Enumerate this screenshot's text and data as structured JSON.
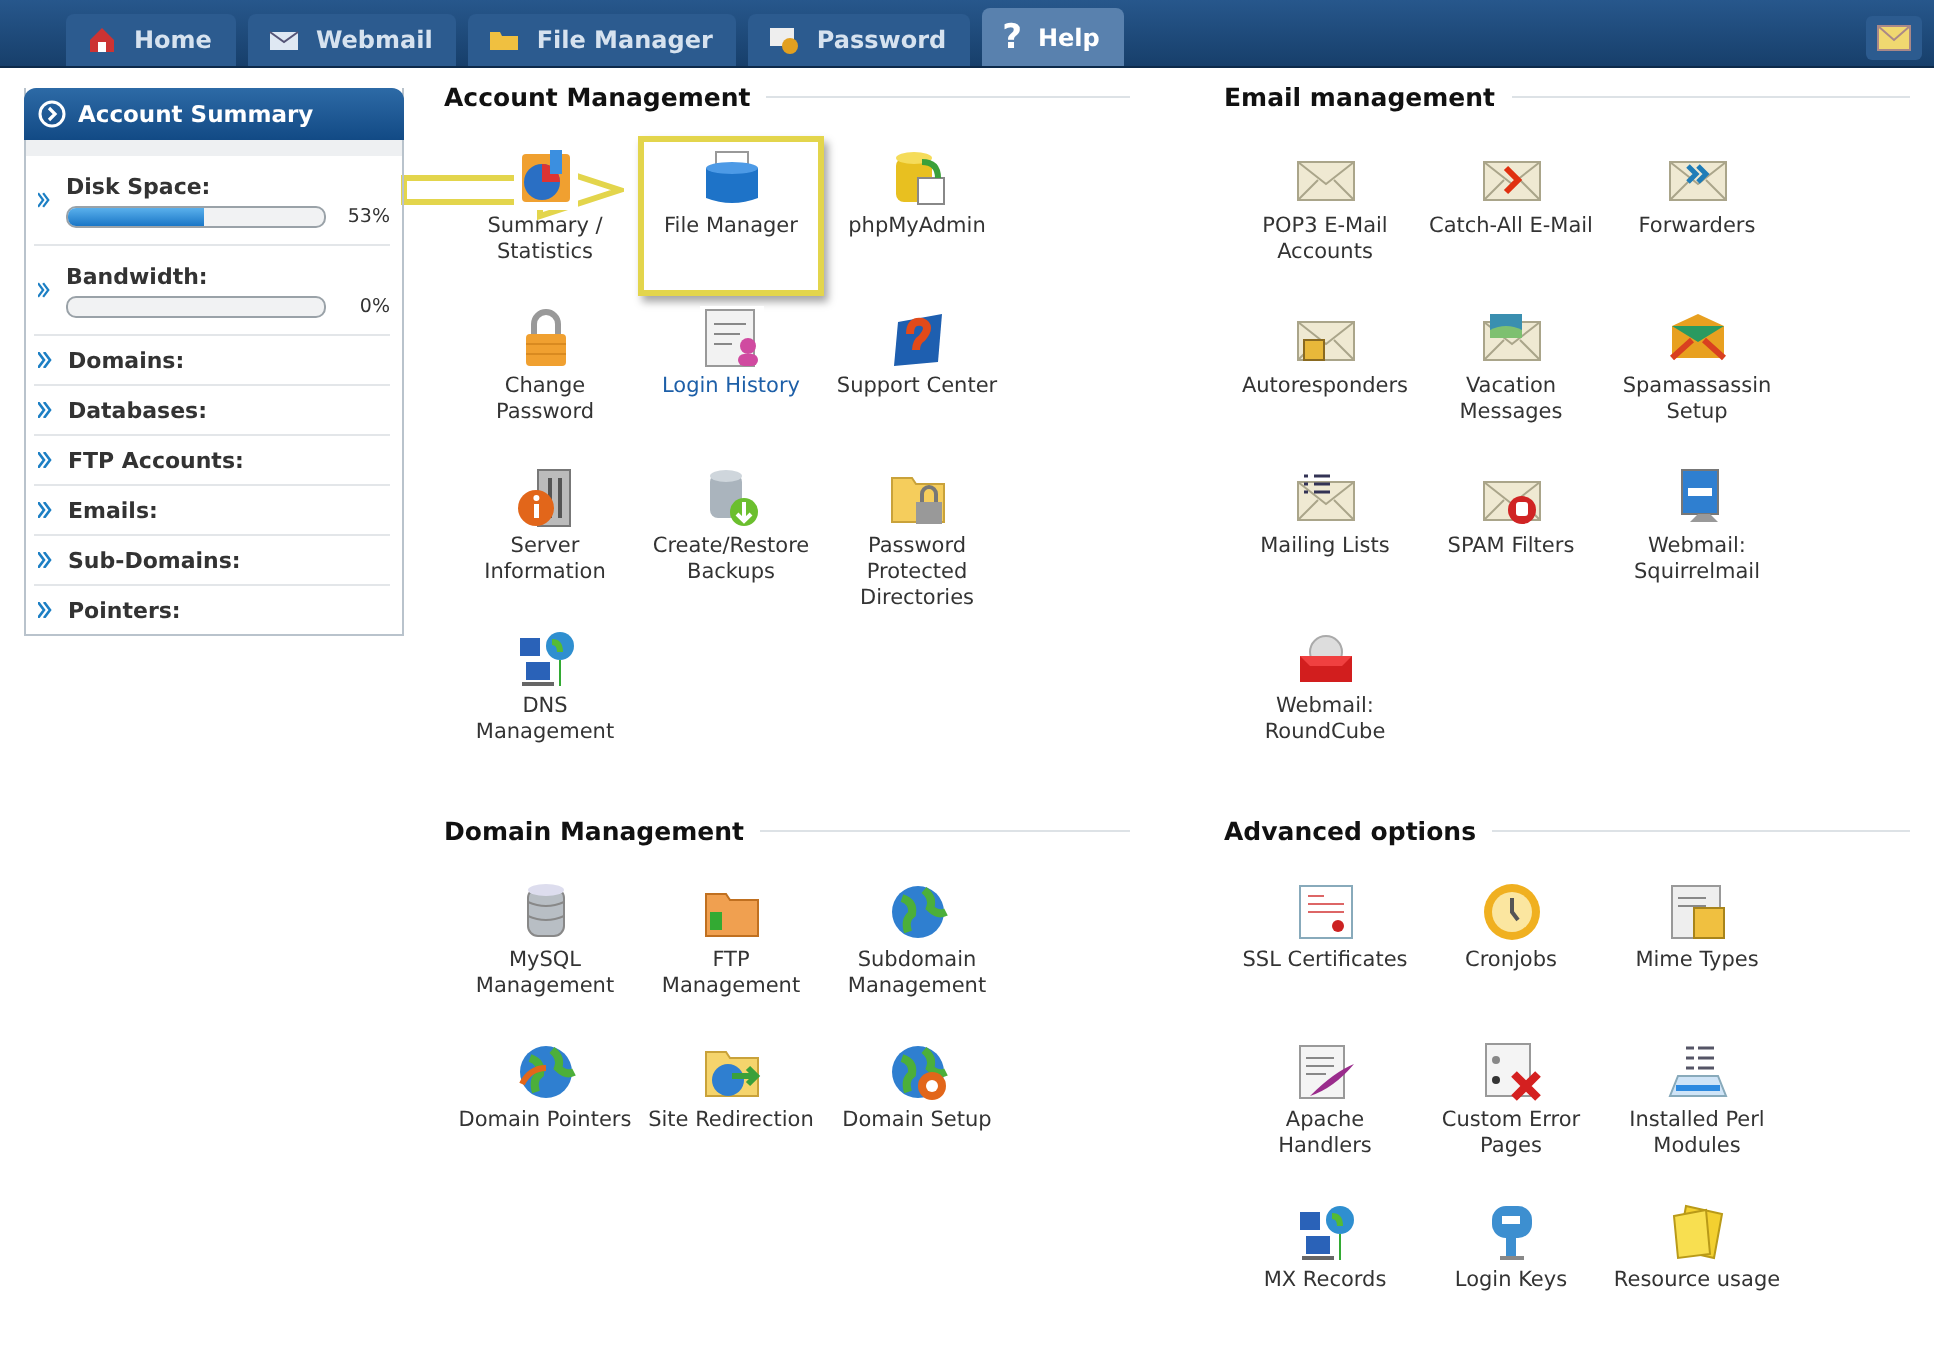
{
  "tabs": [
    {
      "label": "Home",
      "selected": false
    },
    {
      "label": "Webmail",
      "selected": false
    },
    {
      "label": "File Manager",
      "selected": false
    },
    {
      "label": "Password",
      "selected": false
    },
    {
      "label": "Help",
      "glyph": "?",
      "selected": true
    }
  ],
  "sidebar": {
    "title": "Account Summary",
    "items": [
      {
        "kind": "meter",
        "label": "Disk Space:",
        "level": 0.53,
        "reading": "53%"
      },
      {
        "kind": "meter",
        "label": "Bandwidth:",
        "level": 0,
        "reading": "0%"
      },
      {
        "kind": "plain",
        "label": "Domains:"
      },
      {
        "kind": "plain",
        "label": "Databases:"
      },
      {
        "kind": "plain",
        "label": "FTP Accounts:"
      },
      {
        "kind": "plain",
        "label": "Emails:"
      },
      {
        "kind": "plain",
        "label": "Sub-Domains:"
      },
      {
        "kind": "plain",
        "label": "Pointers:"
      }
    ]
  },
  "sections": [
    {
      "title": "Account Management",
      "items": [
        {
          "label": "Summary / Statistics",
          "link": false,
          "highlighted": false
        },
        {
          "label": "File Manager",
          "link": false,
          "highlighted": true
        },
        {
          "label": "phpMyAdmin",
          "link": false,
          "highlighted": false
        },
        {
          "label": "Change Password",
          "link": false,
          "highlighted": false
        },
        {
          "label": "Login History",
          "link": true,
          "highlighted": false
        },
        {
          "label": "Support Center",
          "link": false,
          "highlighted": false
        },
        {
          "label": "Server Information",
          "link": false,
          "highlighted": false
        },
        {
          "label": "Create/Restore Backups",
          "link": false,
          "highlighted": false
        },
        {
          "label": "Password Protected Directories",
          "link": false,
          "highlighted": false
        },
        {
          "label": "DNS Management",
          "link": false,
          "highlighted": false
        }
      ]
    },
    {
      "title": "Email management",
      "items": [
        {
          "label": "POP3 E-Mail Accounts",
          "link": false,
          "highlighted": false
        },
        {
          "label": "Catch-All E-Mail",
          "link": false,
          "highlighted": false
        },
        {
          "label": "Forwarders",
          "link": false,
          "highlighted": false
        },
        {
          "label": "Autoresponders",
          "link": false,
          "highlighted": false
        },
        {
          "label": "Vacation Messages",
          "link": false,
          "highlighted": false
        },
        {
          "label": "Spamassassin Setup",
          "link": false,
          "highlighted": false
        },
        {
          "label": "Mailing Lists",
          "link": false,
          "highlighted": false
        },
        {
          "label": "SPAM Filters",
          "link": false,
          "highlighted": false
        },
        {
          "label": "Webmail: Squirrelmail",
          "link": false,
          "highlighted": false
        },
        {
          "label": "Webmail: RoundCube",
          "link": false,
          "highlighted": false
        }
      ]
    },
    {
      "title": "Domain Management",
      "items": [
        {
          "label": "MySQL Management",
          "link": false,
          "highlighted": false
        },
        {
          "label": "FTP Management",
          "link": false,
          "highlighted": false
        },
        {
          "label": "Subdomain Management",
          "link": false,
          "highlighted": false
        },
        {
          "label": "Domain Pointers",
          "link": false,
          "highlighted": false
        },
        {
          "label": "Site Redirection",
          "link": false,
          "highlighted": false
        },
        {
          "label": "Domain Setup",
          "link": false,
          "highlighted": false
        }
      ]
    },
    {
      "title": "Advanced options",
      "items": [
        {
          "label": "SSL Certificates",
          "link": false,
          "highlighted": false
        },
        {
          "label": "Cronjobs",
          "link": false,
          "highlighted": false
        },
        {
          "label": "Mime Types",
          "link": false,
          "highlighted": false
        },
        {
          "label": "Apache Handlers",
          "link": false,
          "highlighted": false
        },
        {
          "label": "Custom Error Pages",
          "link": false,
          "highlighted": false
        },
        {
          "label": "Installed Perl Modules",
          "link": false,
          "highlighted": false
        },
        {
          "label": "MX Records",
          "link": false,
          "highlighted": false
        },
        {
          "label": "Login Keys",
          "link": false,
          "highlighted": false
        },
        {
          "label": "Resource usage",
          "link": false,
          "highlighted": false
        }
      ]
    }
  ]
}
